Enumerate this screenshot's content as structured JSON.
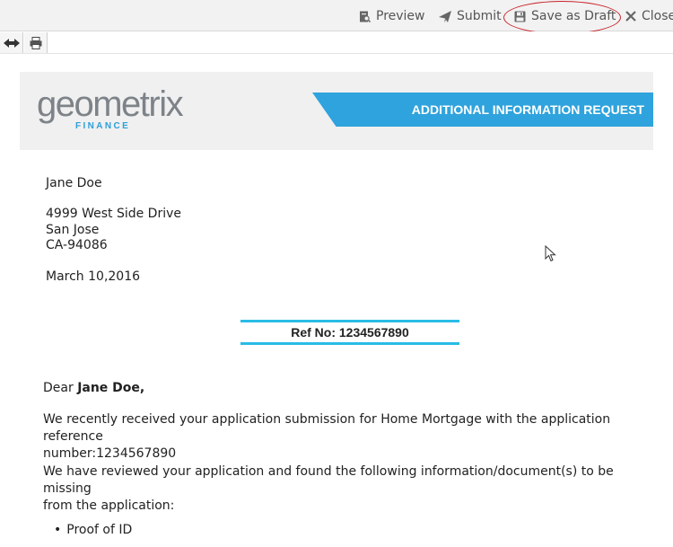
{
  "toolbar": {
    "preview": "Preview",
    "submit": "Submit",
    "save_draft": "Save as Draft",
    "close": "Close"
  },
  "header": {
    "logo_word": "geometrix",
    "logo_sub": "FINANCE",
    "banner": "ADDITIONAL INFORMATION REQUEST"
  },
  "letter": {
    "name": "Jane Doe",
    "address_line1": "4999 West Side Drive",
    "address_line2": "San Jose",
    "address_line3": "CA-94086",
    "date": "March 10,2016",
    "ref": "Ref No: 1234567890",
    "greeting_prefix": "Dear",
    "greeting_name": "Jane Doe,",
    "para1_line1": "We recently received your application submission for Home Mortgage with the application reference",
    "para1_line2": "number:1234567890",
    "para2_line1": "We have reviewed your application and found the following information/document(s) to be missing",
    "para2_line2": "from the application:",
    "missing_items": [
      "Proof of ID"
    ]
  },
  "colors": {
    "accent_blue": "#2fa3dd",
    "ref_rule": "#29bce6",
    "annotation_red": "#c9242b"
  }
}
